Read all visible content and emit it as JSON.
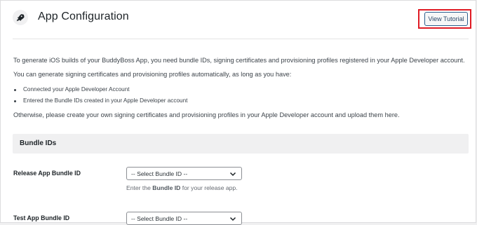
{
  "header": {
    "title": "App Configuration",
    "tutorial_label": "View Tutorial"
  },
  "intro": {
    "paragraph1": "To generate iOS builds of your BuddyBoss App, you need bundle IDs, signing certificates and provisioning profiles registered in your Apple Developer account.",
    "paragraph2": "You can generate signing certificates and provisioning profiles automatically, as long as you have:",
    "bullets": [
      "Connected your Apple Developer Account",
      "Entered the Bundle IDs created in your Apple Developer account"
    ],
    "paragraph3": "Otherwise, please create your own signing certificates and provisioning profiles in your Apple Developer account and upload them here."
  },
  "bundle_section": {
    "title": "Bundle IDs",
    "release": {
      "label": "Release App Bundle ID",
      "selected": "-- Select Bundle ID --",
      "help_prefix": "Enter the ",
      "help_bold": "Bundle ID",
      "help_suffix": " for your release app."
    },
    "test": {
      "label": "Test App Bundle ID",
      "selected": "-- Select Bundle ID --"
    }
  },
  "colors": {
    "highlight": "#e01b24",
    "button_border": "#2c5e8c",
    "section_bg": "#f0f0f1"
  }
}
